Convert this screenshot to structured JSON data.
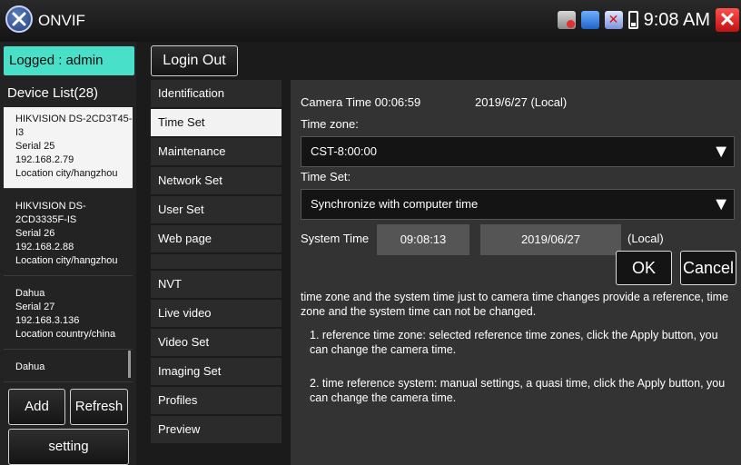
{
  "app": {
    "title": "ONVIF",
    "clock": "9:08 AM",
    "close_glyph": "✕"
  },
  "left": {
    "logged": "Logged : admin",
    "device_list_title": "Device List(28)",
    "devices": [
      {
        "name": "HIKVISION DS-2CD3T45-I3",
        "serial": "Serial  25",
        "ip": "192.168.2.79",
        "location": "Location  city/hangzhou"
      },
      {
        "name": "HIKVISION DS-2CD3335F-IS",
        "serial": "Serial  26",
        "ip": "192.168.2.88",
        "location": "Location  city/hangzhou"
      },
      {
        "name": "Dahua",
        "serial": "Serial  27",
        "ip": "192.168.3.136",
        "location": "Location  country/china"
      },
      {
        "name": "Dahua"
      }
    ],
    "add": "Add",
    "refresh": "Refresh",
    "setting": "setting"
  },
  "login_out": "Login Out",
  "menu": {
    "items": [
      "Identification",
      "Time Set",
      "Maintenance",
      "Network Set",
      "User Set",
      "Web page"
    ],
    "nvt_items": [
      "NVT",
      "Live video",
      "Video Set",
      "Imaging Set",
      "Profiles",
      "Preview"
    ]
  },
  "content": {
    "camera_time": "Camera Time 00:06:59",
    "camera_date": "2019/6/27 (Local)",
    "time_zone_label": "Time zone:",
    "time_zone_value": "CST-8:00:00",
    "time_set_label": "Time Set:",
    "time_set_value": "Synchronize with computer time",
    "system_time_label": "System Time",
    "system_time_value": "09:08:13",
    "system_date_value": "2019/06/27",
    "local": "(Local)",
    "ok": "OK",
    "cancel": "Cancel",
    "desc": "time zone and the system time just to camera time changes provide a reference, time zone and the system time can not be changed.",
    "note1": "1. reference time zone: selected reference time zones, click the Apply button, you can change the camera time.",
    "note2": "2. time reference system: manual settings, a quasi time, click the Apply button, you can change the camera time."
  }
}
